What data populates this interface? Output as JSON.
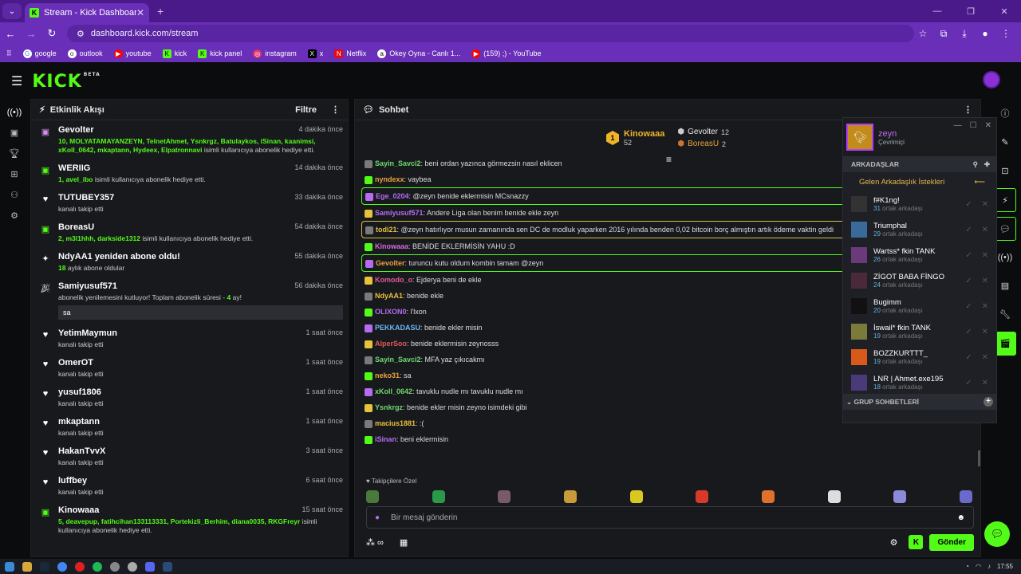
{
  "browser": {
    "tab_title": "Stream - Kick Dashboard",
    "url": "dashboard.kick.com/stream",
    "bookmarks": [
      "google",
      "outlook",
      "youtube",
      "kick",
      "kick panel",
      "instagram",
      "x",
      "Netflix",
      "Okey Oyna - Canlı 1...",
      "(159) ;) - YouTube"
    ]
  },
  "kick": {
    "logo": "KICK",
    "beta": "BETA"
  },
  "activity": {
    "title": "Etkinlik Akışı",
    "filter": "Filtre",
    "events": [
      {
        "name": "Gevolter",
        "time": "4 dakika önce",
        "highlight": "10, MOLYATAMAYANZEYN, TelnetAhmet, Ysnkrgz, Batulaykos, iSinan, kaanimsi, xKoll_0642, mkaptann, Hydeex, Elpatronnavi",
        "text": "isimli kullanıcıya abonelik hediye etti."
      },
      {
        "name": "WERIIG",
        "time": "14 dakika önce",
        "highlight": "1, avel_ibo",
        "text": "isimli kullanıcıya abonelik hediye etti."
      },
      {
        "name": "TUTUBEY357",
        "time": "33 dakika önce",
        "highlight": "",
        "text": "kanalı takip etti"
      },
      {
        "name": "BoreasU",
        "time": "54 dakika önce",
        "highlight": "2, m3l1hhh, darkside1312",
        "text": "isimli kullanıcıya abonelik hediye etti."
      },
      {
        "name": "NdyAA1 yeniden abone oldu!",
        "time": "55 dakika önce",
        "highlight": "18",
        "text": "aylık abone oldular"
      },
      {
        "name": "Samiyusuf571",
        "time": "56 dakika önce",
        "highlight": "",
        "text": "abonelik yenilemesini kutluyor! Toplam abonelik süresi -",
        "months": "4",
        "months_suffix": "ay!",
        "message": "sa"
      },
      {
        "name": "YetimMaymun",
        "time": "1 saat önce",
        "highlight": "",
        "text": "kanalı takip etti"
      },
      {
        "name": "OmerOT",
        "time": "1 saat önce",
        "highlight": "",
        "text": "kanalı takip etti"
      },
      {
        "name": "yusuf1806",
        "time": "1 saat önce",
        "highlight": "",
        "text": "kanalı takip etti"
      },
      {
        "name": "mkaptann",
        "time": "1 saat önce",
        "highlight": "",
        "text": "kanalı takip etti"
      },
      {
        "name": "HakanTvvX",
        "time": "3 saat önce",
        "highlight": "",
        "text": "kanalı takip etti"
      },
      {
        "name": "luffbey",
        "time": "6 saat önce",
        "highlight": "",
        "text": "kanalı takip etti"
      },
      {
        "name": "Kinowaaa",
        "time": "15 saat önce",
        "highlight": "5, deavepup, fatihcihan133113331, Portekizli_Berhim, diana0035, RKGFreyr",
        "text": "isimli kullanıcıya abonelik hediye etti."
      }
    ]
  },
  "chat": {
    "title": "Sohbet",
    "leaders": {
      "first": {
        "rank": "1",
        "name": "Kinowaaa",
        "count": "52"
      },
      "second": {
        "name": "Gevolter",
        "count": "12"
      },
      "third": {
        "name": "BoreasU",
        "count": "2"
      }
    },
    "messages": [
      {
        "user": "Sayin_Savci2",
        "color": "#6fd96f",
        "text": ": beni ordan yazınca görmezsin nasıl eklicen",
        "style": ""
      },
      {
        "user": "nyndexx",
        "color": "#e8a23b",
        "text": ": vaybea",
        "style": ""
      },
      {
        "user": "Ege_0204",
        "color": "#b56cf0",
        "text": ": @zeyn benide eklermisin MCsnazzy",
        "style": "hl"
      },
      {
        "user": "Samiyusuf571",
        "color": "#b56cf0",
        "text": ": Andere Liga olan benim benide ekle zeyn",
        "style": ""
      },
      {
        "user": "todi21",
        "color": "#e8c23b",
        "text": ": @zeyn hatırlıyor musun zamanında sen DC de modluk yaparken 2016 yılında benden 0,02 bitcoin borç almıştın artık ödeme vaktin geldi",
        "style": "hl2"
      },
      {
        "user": "Kinowaaa",
        "color": "#d46ce0",
        "text": ": BENİDE EKLERMİSİN YAHU :D",
        "style": ""
      },
      {
        "user": "Gevolter",
        "color": "#e8a23b",
        "text": ": turuncu kutu oldum kombin tamam @zeyn",
        "style": "hl"
      },
      {
        "user": "Komodo_o",
        "color": "#e05a9a",
        "text": ": Ejderya beni de ekle",
        "style": ""
      },
      {
        "user": "NdyAA1",
        "color": "#e8c23b",
        "text": ": benide ekle",
        "style": ""
      },
      {
        "user": "OLIXON0",
        "color": "#b56cf0",
        "text": ": l'lxon",
        "style": ""
      },
      {
        "user": "PEKKADASU",
        "color": "#6cb8f0",
        "text": ": benide ekler misin",
        "style": ""
      },
      {
        "user": "AlperSoo",
        "color": "#e05a5a",
        "text": ": benide eklermisin zeynosss",
        "style": ""
      },
      {
        "user": "Sayin_Savci2",
        "color": "#6fd96f",
        "text": ": MFA yaz çıkıcakmı",
        "style": ""
      },
      {
        "user": "neko31",
        "color": "#e8a23b",
        "text": ": sa",
        "style": ""
      },
      {
        "user": "xKoll_0642",
        "color": "#6fd96f",
        "text": ": tavuklu nudle mı tavuklu nudle mı",
        "style": ""
      },
      {
        "user": "Ysnkrgz",
        "color": "#6fd96f",
        "text": ": benide ekler misin zeyno isimdeki gibi",
        "style": ""
      },
      {
        "user": "macius1881",
        "color": "#e8c23b",
        "text": ": :(",
        "style": ""
      },
      {
        "user": "iSinan",
        "color": "#b56cf0",
        "text": ": beni eklermisin",
        "style": ""
      }
    ],
    "followers_label": "Takipçilere Özel",
    "input_placeholder": "Bir mesaj gönderin",
    "send": "Gönder"
  },
  "friends": {
    "user": "zeyn",
    "status": "Çevrimiçi",
    "section": "ARKADAŞLAR",
    "requests": "Gelen Arkadaşlık İstekleri",
    "mutual_suffix": "ortak arkadaşı",
    "list": [
      {
        "name": "f#K1ng!",
        "mutual": "31"
      },
      {
        "name": "Triumphal",
        "mutual": "29"
      },
      {
        "name": "Wartss* fkin TANK",
        "mutual": "26"
      },
      {
        "name": "ZİGOT BABA FİNGO",
        "mutual": "24"
      },
      {
        "name": "Bugimm",
        "mutual": "20"
      },
      {
        "name": "İswail* fkin TANK",
        "mutual": "19"
      },
      {
        "name": "BOZZKURTTT_",
        "mutual": "19"
      },
      {
        "name": "LNR | Ahmet.exe195",
        "mutual": "18"
      }
    ],
    "group": "GRUP SOHBETLERİ"
  },
  "taskbar": {
    "time": "17:55"
  }
}
